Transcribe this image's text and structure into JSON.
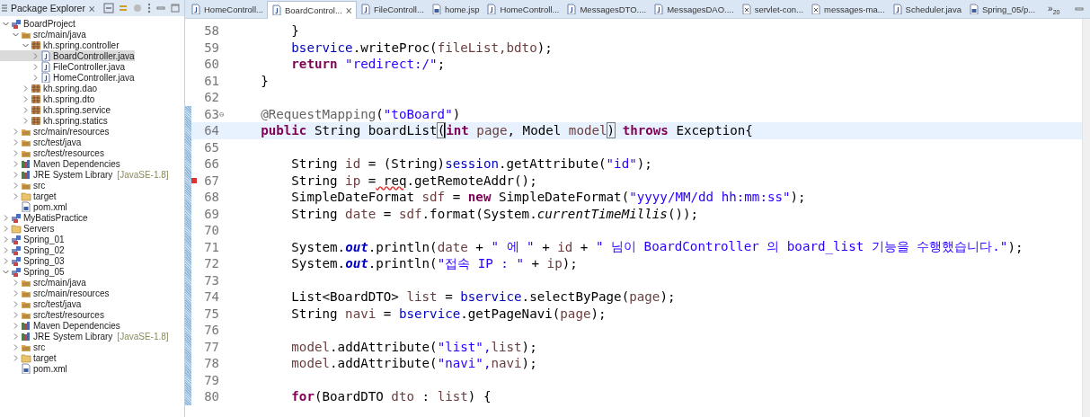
{
  "explorer": {
    "title": "Package Explorer",
    "close": "⨯",
    "tree": [
      {
        "label": "BoardProject",
        "kind": "project",
        "expanded": true,
        "selected": false,
        "children": [
          {
            "label": "src/main/java",
            "kind": "srcfolder",
            "expanded": true,
            "selected": false,
            "children": [
              {
                "label": "kh.spring.controller",
                "kind": "package",
                "expanded": true,
                "selected": false,
                "children": [
                  {
                    "label": "BoardController.java",
                    "kind": "java",
                    "expanded": false,
                    "selected": true
                  },
                  {
                    "label": "FileController.java",
                    "kind": "java",
                    "expanded": false,
                    "selected": false
                  },
                  {
                    "label": "HomeController.java",
                    "kind": "java",
                    "expanded": false,
                    "selected": false
                  }
                ]
              },
              {
                "label": "kh.spring.dao",
                "kind": "package",
                "expanded": false,
                "selected": false
              },
              {
                "label": "kh.spring.dto",
                "kind": "package",
                "expanded": false,
                "selected": false
              },
              {
                "label": "kh.spring.service",
                "kind": "package",
                "expanded": false,
                "selected": false
              },
              {
                "label": "kh.spring.statics",
                "kind": "package",
                "expanded": false,
                "selected": false
              }
            ]
          },
          {
            "label": "src/main/resources",
            "kind": "srcfolder",
            "expanded": false,
            "selected": false
          },
          {
            "label": "src/test/java",
            "kind": "srcfolder",
            "expanded": false,
            "selected": false
          },
          {
            "label": "src/test/resources",
            "kind": "srcfolder",
            "expanded": false,
            "selected": false
          },
          {
            "label": "Maven Dependencies",
            "kind": "library",
            "expanded": false,
            "selected": false
          },
          {
            "label": "JRE System Library",
            "note": "[JavaSE-1.8]",
            "kind": "library",
            "expanded": false,
            "selected": false
          },
          {
            "label": "src",
            "kind": "srcfolder",
            "expanded": false,
            "selected": false
          },
          {
            "label": "target",
            "kind": "folder",
            "expanded": false,
            "selected": false
          },
          {
            "label": "pom.xml",
            "kind": "file",
            "selected": false
          }
        ]
      },
      {
        "label": "MyBatisPractice",
        "kind": "project",
        "expanded": false,
        "selected": false
      },
      {
        "label": "Servers",
        "kind": "folder",
        "expanded": false,
        "selected": false
      },
      {
        "label": "Spring_01",
        "kind": "project",
        "expanded": false,
        "selected": false
      },
      {
        "label": "Spring_02",
        "kind": "project",
        "expanded": false,
        "selected": false
      },
      {
        "label": "Spring_03",
        "kind": "project",
        "expanded": false,
        "selected": false
      },
      {
        "label": "Spring_05",
        "kind": "project",
        "expanded": true,
        "selected": false,
        "children": [
          {
            "label": "src/main/java",
            "kind": "srcfolder",
            "expanded": false,
            "selected": false
          },
          {
            "label": "src/main/resources",
            "kind": "srcfolder",
            "expanded": false,
            "selected": false
          },
          {
            "label": "src/test/java",
            "kind": "srcfolder",
            "expanded": false,
            "selected": false
          },
          {
            "label": "src/test/resources",
            "kind": "srcfolder",
            "expanded": false,
            "selected": false
          },
          {
            "label": "Maven Dependencies",
            "kind": "library",
            "expanded": false,
            "selected": false
          },
          {
            "label": "JRE System Library",
            "note": "[JavaSE-1.8]",
            "kind": "library",
            "expanded": false,
            "selected": false
          },
          {
            "label": "src",
            "kind": "srcfolder",
            "expanded": false,
            "selected": false
          },
          {
            "label": "target",
            "kind": "folder",
            "expanded": false,
            "selected": false
          },
          {
            "label": "pom.xml",
            "kind": "file",
            "selected": false
          }
        ]
      }
    ]
  },
  "tabs": [
    {
      "label": "HomeControll...",
      "kind": "java",
      "selected": false
    },
    {
      "label": "BoardControl...",
      "kind": "java",
      "selected": true,
      "close": "⨯"
    },
    {
      "label": "FileControll...",
      "kind": "java",
      "selected": false
    },
    {
      "label": "home.jsp",
      "kind": "file",
      "selected": false
    },
    {
      "label": "HomeControll...",
      "kind": "java",
      "selected": false
    },
    {
      "label": "MessagesDTO....",
      "kind": "java",
      "selected": false
    },
    {
      "label": "MessagesDAO....",
      "kind": "java",
      "selected": false
    },
    {
      "label": "servlet-con...",
      "kind": "xml",
      "selected": false
    },
    {
      "label": "messages-ma...",
      "kind": "xml",
      "selected": false
    },
    {
      "label": "Scheduler.java",
      "kind": "java",
      "selected": false
    },
    {
      "label": "Spring_05/p...",
      "kind": "file",
      "selected": false
    }
  ],
  "overflow": {
    "mark": "»",
    "count": "20"
  },
  "code": [
    {
      "children": [
        {
          "children": [
            {
              "n": "58",
              "current": false,
              "changed": false,
              "error": false,
              "tokens": [
                {
                  "kind": "plain",
                  "text": "}"
                }
              ]
            },
            {
              "n": "59",
              "current": false,
              "changed": false,
              "error": false,
              "tokens": [
                {
                  "kind": "field",
                  "text": "bservice"
                },
                {
                  "kind": "plain",
                  "text": ".writeProc("
                },
                {
                  "kind": "param",
                  "text": "fileList,"
                },
                {
                  "kind": "param",
                  "text": "bdto"
                },
                {
                  "kind": "plain",
                  "text": ");"
                }
              ]
            },
            {
              "n": "60",
              "current": false,
              "changed": false,
              "error": false,
              "tokens": [
                {
                  "kind": "kw",
                  "text": "return"
                },
                {
                  "kind": "str",
                  "text": " \"redirect:/\""
                },
                {
                  "kind": "plain",
                  "text": ";"
                }
              ]
            }
          ]
        },
        {
          "n": "61",
          "current": false,
          "changed": false,
          "error": false,
          "tokens": [
            {
              "kind": "plain",
              "text": "}"
            }
          ]
        },
        {
          "n": "62",
          "current": false,
          "changed": false,
          "error": false
        },
        {
          "n": "63",
          "current": false,
          "changed": true,
          "error": false,
          "fold": "⊖",
          "tokens": [
            {
              "kind": "annot",
              "text": "@RequestMapping"
            },
            {
              "kind": "plain",
              "text": "("
            },
            {
              "kind": "str",
              "text": "\"toBoard\""
            },
            {
              "kind": "plain",
              "text": ")"
            }
          ]
        },
        {
          "n": "64",
          "current": true,
          "changed": true,
          "error": false,
          "tokens": [
            {
              "kind": "kw",
              "text": "public"
            },
            {
              "kind": "plain",
              "text": " String boardList"
            },
            {
              "kind": "bracket",
              "text": "("
            },
            {
              "kind": "kw",
              "text": "int"
            },
            {
              "kind": "param",
              "text": " page"
            },
            {
              "kind": "plain",
              "text": ", Model"
            },
            {
              "kind": "param",
              "text": " model"
            },
            {
              "kind": "bracket",
              "text": ")"
            },
            {
              "kind": "kw",
              "text": " throws"
            },
            {
              "kind": "plain",
              "text": " Exception{"
            }
          ],
          "children": [
            {
              "n": "65",
              "current": false,
              "changed": true,
              "error": false
            },
            {
              "n": "66",
              "current": false,
              "changed": true,
              "error": false,
              "tokens": [
                {
                  "kind": "plain",
                  "text": "String"
                },
                {
                  "kind": "param",
                  "text": " id"
                },
                {
                  "kind": "plain",
                  "text": " = (String)"
                },
                {
                  "kind": "field",
                  "text": "session"
                },
                {
                  "kind": "plain",
                  "text": ".getAttribute("
                },
                {
                  "kind": "str",
                  "text": "\"id\""
                },
                {
                  "kind": "plain",
                  "text": ");"
                }
              ]
            },
            {
              "n": "67",
              "current": false,
              "changed": true,
              "error": true,
              "tokens": [
                {
                  "kind": "plain",
                  "text": "String"
                },
                {
                  "kind": "param",
                  "text": " ip"
                },
                {
                  "kind": "plain",
                  "text": " ="
                },
                {
                  "kind": "warn",
                  "text": " req"
                },
                {
                  "kind": "plain",
                  "text": ".getRemoteAddr();"
                }
              ]
            },
            {
              "n": "68",
              "current": false,
              "changed": true,
              "error": false,
              "tokens": [
                {
                  "kind": "plain",
                  "text": "SimpleDateFormat"
                },
                {
                  "kind": "param",
                  "text": " sdf"
                },
                {
                  "kind": "plain",
                  "text": " ="
                },
                {
                  "kind": "kw",
                  "text": " new"
                },
                {
                  "kind": "plain",
                  "text": " SimpleDateFormat("
                },
                {
                  "kind": "str",
                  "text": "\"yyyy/MM/dd hh:mm:ss\""
                },
                {
                  "kind": "plain",
                  "text": ");"
                }
              ]
            },
            {
              "n": "69",
              "current": false,
              "changed": true,
              "error": false,
              "tokens": [
                {
                  "kind": "plain",
                  "text": "String"
                },
                {
                  "kind": "param",
                  "text": " date"
                },
                {
                  "kind": "plain",
                  "text": " ="
                },
                {
                  "kind": "param",
                  "text": " sdf"
                },
                {
                  "kind": "plain",
                  "text": ".format(System."
                },
                {
                  "kind": "smethod",
                  "text": "currentTimeMillis"
                },
                {
                  "kind": "plain",
                  "text": "());"
                }
              ]
            },
            {
              "n": "70",
              "current": false,
              "changed": true,
              "error": false
            },
            {
              "n": "71",
              "current": false,
              "changed": true,
              "error": false,
              "tokens": [
                {
                  "kind": "plain",
                  "text": "System."
                },
                {
                  "kind": "static",
                  "text": "out"
                },
                {
                  "kind": "plain",
                  "text": ".println("
                },
                {
                  "kind": "param",
                  "text": "date"
                },
                {
                  "kind": "plain",
                  "text": " +"
                },
                {
                  "kind": "str",
                  "text": " \" 에 \""
                },
                {
                  "kind": "plain",
                  "text": " +"
                },
                {
                  "kind": "param",
                  "text": " id"
                },
                {
                  "kind": "plain",
                  "text": " +"
                },
                {
                  "kind": "str",
                  "text": " \" 님이 BoardController 의 board_list 기능을 수행했습니다.\""
                },
                {
                  "kind": "plain",
                  "text": ");"
                }
              ]
            },
            {
              "n": "72",
              "current": false,
              "changed": true,
              "error": false,
              "tokens": [
                {
                  "kind": "plain",
                  "text": "System."
                },
                {
                  "kind": "static",
                  "text": "out"
                },
                {
                  "kind": "plain",
                  "text": ".println("
                },
                {
                  "kind": "str",
                  "text": "\"접속 IP : \""
                },
                {
                  "kind": "plain",
                  "text": " +"
                },
                {
                  "kind": "param",
                  "text": " ip"
                },
                {
                  "kind": "plain",
                  "text": ");"
                }
              ]
            },
            {
              "n": "73",
              "current": false,
              "changed": true,
              "error": false
            },
            {
              "n": "74",
              "current": false,
              "changed": true,
              "error": false,
              "tokens": [
                {
                  "kind": "plain",
                  "text": "List<BoardDTO>"
                },
                {
                  "kind": "param",
                  "text": " list"
                },
                {
                  "kind": "plain",
                  "text": " ="
                },
                {
                  "kind": "field",
                  "text": " bservice"
                },
                {
                  "kind": "plain",
                  "text": ".selectByPage("
                },
                {
                  "kind": "param",
                  "text": "page"
                },
                {
                  "kind": "plain",
                  "text": ");"
                }
              ]
            },
            {
              "n": "75",
              "current": false,
              "changed": true,
              "error": false,
              "tokens": [
                {
                  "kind": "plain",
                  "text": "String"
                },
                {
                  "kind": "param",
                  "text": " navi"
                },
                {
                  "kind": "plain",
                  "text": " ="
                },
                {
                  "kind": "field",
                  "text": " bservice"
                },
                {
                  "kind": "plain",
                  "text": ".getPageNavi("
                },
                {
                  "kind": "param",
                  "text": "page"
                },
                {
                  "kind": "plain",
                  "text": ");"
                }
              ]
            },
            {
              "n": "76",
              "current": false,
              "changed": true,
              "error": false
            },
            {
              "n": "77",
              "current": false,
              "changed": true,
              "error": false,
              "tokens": [
                {
                  "kind": "param",
                  "text": "model"
                },
                {
                  "kind": "plain",
                  "text": ".addAttribute("
                },
                {
                  "kind": "str",
                  "text": "\"list\","
                },
                {
                  "kind": "param",
                  "text": "list"
                },
                {
                  "kind": "plain",
                  "text": ");"
                }
              ]
            },
            {
              "n": "78",
              "current": false,
              "changed": true,
              "error": false,
              "tokens": [
                {
                  "kind": "param",
                  "text": "model"
                },
                {
                  "kind": "plain",
                  "text": ".addAttribute("
                },
                {
                  "kind": "str",
                  "text": "\"navi\","
                },
                {
                  "kind": "param",
                  "text": "navi"
                },
                {
                  "kind": "plain",
                  "text": ");"
                }
              ]
            },
            {
              "n": "79",
              "current": false,
              "changed": true,
              "error": false
            },
            {
              "n": "80",
              "current": false,
              "changed": true,
              "error": false,
              "tokens": [
                {
                  "kind": "kw",
                  "text": "for"
                },
                {
                  "kind": "plain",
                  "text": "(BoardDTO"
                },
                {
                  "kind": "param",
                  "text": " dto"
                },
                {
                  "kind": "plain",
                  "text": " :"
                },
                {
                  "kind": "param",
                  "text": " list"
                },
                {
                  "kind": "plain",
                  "text": ") {"
                }
              ]
            }
          ]
        }
      ]
    }
  ]
}
